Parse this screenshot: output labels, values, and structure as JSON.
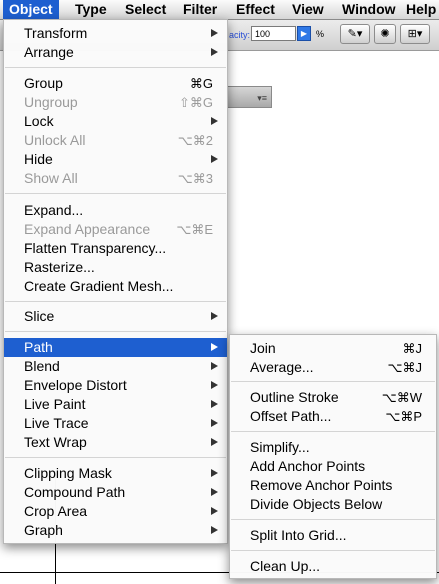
{
  "menubar": {
    "items": [
      "Object",
      "Type",
      "Select",
      "Filter",
      "Effect",
      "View",
      "Window",
      "Help"
    ]
  },
  "toolbar": {
    "opacity_label": "acity:",
    "opacity_value": "100",
    "percent": "%"
  },
  "object_menu": {
    "transform": "Transform",
    "arrange": "Arrange",
    "group": "Group",
    "group_sc": "⌘G",
    "ungroup": "Ungroup",
    "ungroup_sc": "⇧⌘G",
    "lock": "Lock",
    "unlock_all": "Unlock All",
    "unlock_all_sc": "⌥⌘2",
    "hide": "Hide",
    "show_all": "Show All",
    "show_all_sc": "⌥⌘3",
    "expand": "Expand...",
    "expand_appearance": "Expand Appearance",
    "expand_appearance_sc": "⌥⌘E",
    "flatten_transparency": "Flatten Transparency...",
    "rasterize": "Rasterize...",
    "create_gradient_mesh": "Create Gradient Mesh...",
    "slice": "Slice",
    "path": "Path",
    "blend": "Blend",
    "envelope_distort": "Envelope Distort",
    "live_paint": "Live Paint",
    "live_trace": "Live Trace",
    "text_wrap": "Text Wrap",
    "clipping_mask": "Clipping Mask",
    "compound_path": "Compound Path",
    "crop_area": "Crop Area",
    "graph": "Graph"
  },
  "path_submenu": {
    "join": "Join",
    "join_sc": "⌘J",
    "average": "Average...",
    "average_sc": "⌥⌘J",
    "outline_stroke": "Outline Stroke",
    "outline_stroke_sc": "⌥⌘W",
    "offset_path": "Offset Path...",
    "offset_path_sc": "⌥⌘P",
    "simplify": "Simplify...",
    "add_anchor_points": "Add Anchor Points",
    "remove_anchor_points": "Remove Anchor Points",
    "divide_objects_below": "Divide Objects Below",
    "split_into_grid": "Split Into Grid...",
    "clean_up": "Clean Up..."
  },
  "colors": {
    "highlight": "#1e5fd0",
    "disabled_text": "#9a9a9a"
  }
}
